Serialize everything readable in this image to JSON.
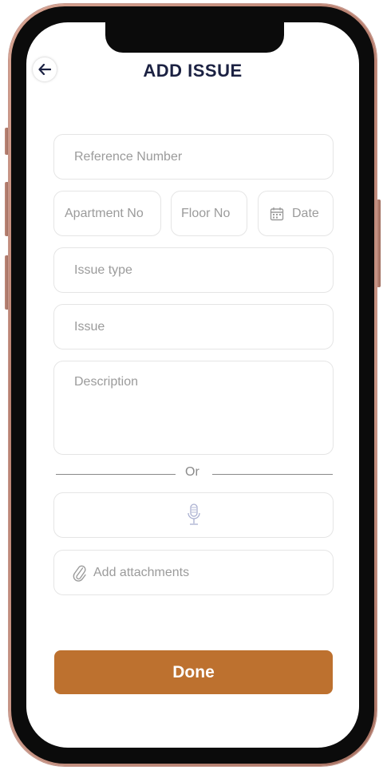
{
  "header": {
    "title": "ADD ISSUE",
    "back_icon": "arrow-left-icon"
  },
  "form": {
    "reference_number": {
      "placeholder": "Reference Number",
      "value": ""
    },
    "apartment_no": {
      "placeholder": "Apartment No",
      "value": ""
    },
    "floor_no": {
      "placeholder": "Floor No",
      "value": ""
    },
    "date": {
      "placeholder": "Date",
      "value": "",
      "icon": "calendar-icon"
    },
    "issue_type": {
      "placeholder": "Issue type",
      "value": ""
    },
    "issue": {
      "placeholder": "Issue",
      "value": ""
    },
    "description": {
      "placeholder": "Description",
      "value": ""
    },
    "divider_text": "Or",
    "voice_input": {
      "icon": "microphone-icon"
    },
    "attachments": {
      "label": "Add attachments",
      "icon": "paperclip-icon"
    }
  },
  "actions": {
    "done_label": "Done"
  },
  "colors": {
    "title": "#1b2142",
    "accent": "#bd712f",
    "border": "#e5e5e5",
    "placeholder": "#9b9b9b",
    "frame": "#b88070"
  }
}
